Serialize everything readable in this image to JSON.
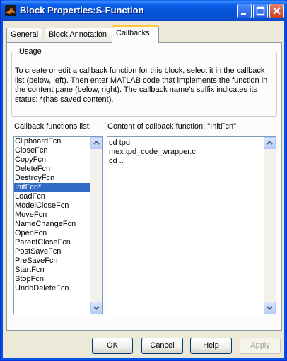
{
  "window": {
    "title": "Block Properties:S-Function"
  },
  "tabs": [
    {
      "label": "General"
    },
    {
      "label": "Block Annotation"
    },
    {
      "label": "Callbacks"
    }
  ],
  "usage": {
    "legend": "Usage",
    "text": "To create or edit a callback function for this block, select it in the callback list (below, left). Then enter MATLAB code that implements the function in the content pane (below, right). The callback name's suffix indicates its status: *(has saved content)."
  },
  "callbacks_list": {
    "label": "Callback functions list:",
    "items": [
      "ClipboardFcn",
      "CloseFcn",
      "CopyFcn",
      "DeleteFcn",
      "DestroyFcn",
      "InitFcn*",
      "LoadFcn",
      "ModelCloseFcn",
      "MoveFcn",
      "NameChangeFcn",
      "OpenFcn",
      "ParentCloseFcn",
      "PostSaveFcn",
      "PreSaveFcn",
      "StartFcn",
      "StopFcn",
      "UndoDeleteFcn"
    ],
    "selected_index": 5
  },
  "content_pane": {
    "label": "Content of callback function: \"InitFcn\"",
    "lines": [
      "cd tpd",
      "mex tpd_code_wrapper.c",
      "cd .."
    ]
  },
  "buttons": {
    "ok": "OK",
    "cancel": "Cancel",
    "help": "Help",
    "apply": "Apply"
  },
  "colors": {
    "title_bar": "#0553d8",
    "selection": "#316ac5",
    "active_tab_accent": "#ffc83c"
  },
  "icons": {
    "app": "matlab-logo-icon",
    "minimize": "minimize-icon",
    "maximize": "maximize-icon",
    "close": "close-icon"
  }
}
